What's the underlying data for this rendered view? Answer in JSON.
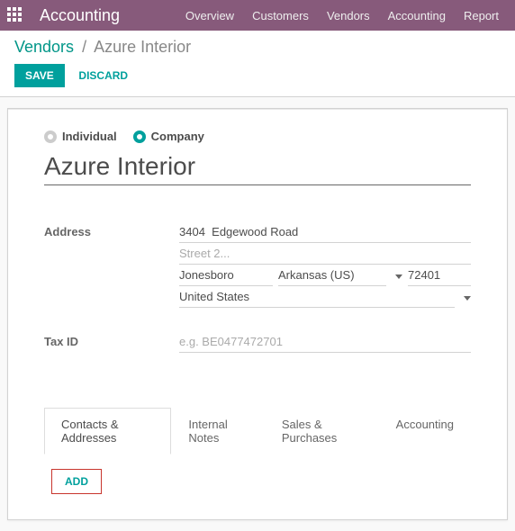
{
  "navbar": {
    "brand": "Accounting",
    "menu": [
      "Overview",
      "Customers",
      "Vendors",
      "Accounting",
      "Report"
    ]
  },
  "breadcrumb": {
    "parent": "Vendors",
    "current": "Azure Interior"
  },
  "actions": {
    "save": "SAVE",
    "discard": "DISCARD"
  },
  "company_type": {
    "individual": "Individual",
    "company": "Company",
    "selected": "company"
  },
  "record": {
    "name": "Azure Interior"
  },
  "labels": {
    "address": "Address",
    "tax_id": "Tax ID"
  },
  "address": {
    "street": "3404  Edgewood Road",
    "street2_placeholder": "Street 2...",
    "city": "Jonesboro",
    "state": "Arkansas (US)",
    "zip": "72401",
    "country": "United States"
  },
  "tax_id": {
    "value": "",
    "placeholder": "e.g. BE0477472701"
  },
  "tabs": {
    "items": [
      {
        "label": "Contacts & Addresses"
      },
      {
        "label": "Internal Notes"
      },
      {
        "label": "Sales & Purchases"
      },
      {
        "label": "Accounting"
      }
    ],
    "active_index": 0
  },
  "contacts": {
    "add_label": "ADD"
  }
}
